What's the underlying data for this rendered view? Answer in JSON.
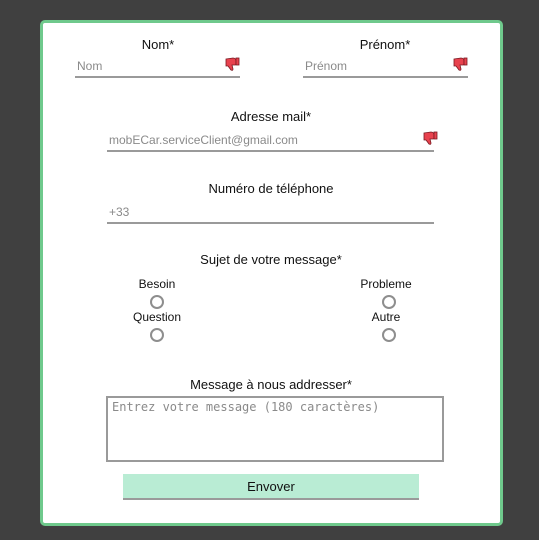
{
  "form": {
    "nom": {
      "label": "Nom*",
      "placeholder": "Nom"
    },
    "prenom": {
      "label": "Prénom*",
      "placeholder": "Prénom"
    },
    "email": {
      "label": "Adresse mail*",
      "placeholder": "mobECar.serviceClient@gmail.com"
    },
    "phone": {
      "label": "Numéro de téléphone",
      "placeholder": "+33"
    },
    "subject": {
      "label": "Sujet de votre message*",
      "options": [
        "Besoin",
        "Probleme",
        "Question",
        "Autre"
      ]
    },
    "message": {
      "label": "Message à nous addresser*",
      "placeholder": "Entrez votre message (180 caractères)"
    },
    "submit_label": "Envover"
  },
  "icons": {
    "field_status": "thumbs-down-icon"
  },
  "colors": {
    "border_accent": "#6fc98c",
    "button_bg": "#b9ecd4",
    "icon_red": "#e8424e"
  }
}
